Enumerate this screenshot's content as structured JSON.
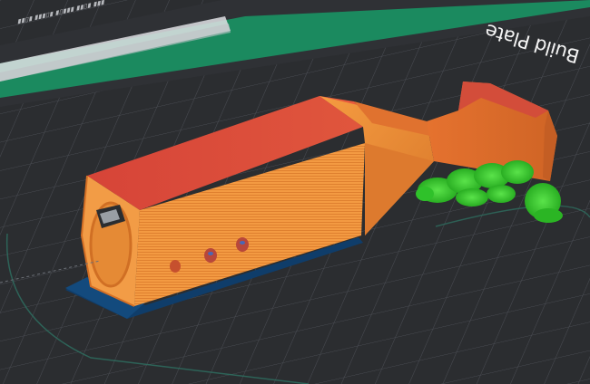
{
  "viewport": {
    "background": "#2b2d30",
    "grid_color": "#50535a",
    "plate_label": "Build Plate"
  },
  "layers": {
    "wall_color": "#f58c2c",
    "top_color": "#d94a3c",
    "support_color": "#35c92f",
    "raft_color": "#0f3d6a",
    "travel_color": "#2e6d5f",
    "grid_accent": "#18a66d"
  },
  "icons": {
    "orbit": "grid-plane-icon"
  }
}
